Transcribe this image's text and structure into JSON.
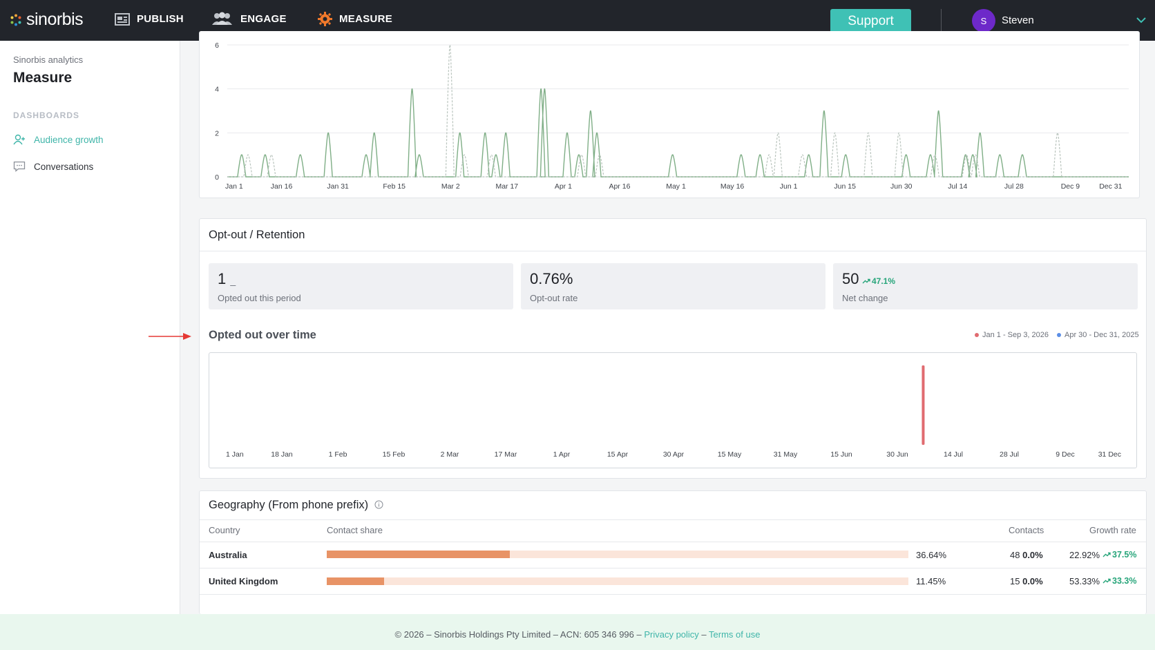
{
  "brand": {
    "name": "sinorbis"
  },
  "nav": {
    "publish": "PUBLISH",
    "engage": "ENGAGE",
    "measure": "MEASURE",
    "support": "Support",
    "user_initial": "S",
    "user_name": "Steven"
  },
  "sidebar": {
    "subtitle": "Sinorbis analytics",
    "title": "Measure",
    "section": "DASHBOARDS",
    "items": [
      {
        "label": "Audience growth",
        "icon": "user-icon",
        "active": true
      },
      {
        "label": "Conversations",
        "icon": "chat-icon",
        "active": false
      }
    ]
  },
  "top_chart": {
    "y_ticks": [
      "0",
      "2",
      "4",
      "6"
    ],
    "x_ticks": [
      "Jan 1",
      "Jan 16",
      "Jan 31",
      "Feb 15",
      "Mar 2",
      "Mar 17",
      "Apr 1",
      "Apr 16",
      "May 1",
      "May 16",
      "Jun 1",
      "Jun 15",
      "Jun 30",
      "Jul 14",
      "Jul 28",
      "Dec 9",
      "Dec 31"
    ]
  },
  "optout": {
    "title": "Opt-out / Retention",
    "stats": [
      {
        "value": "1",
        "suffix": "_",
        "label": "Opted out this period"
      },
      {
        "value": "0.76%",
        "label": "Opt-out rate"
      },
      {
        "value": "50",
        "trend": "47.1%",
        "label": "Net change"
      }
    ],
    "chart_title": "Opted out over time",
    "legend": [
      {
        "label": "Jan 1 - Sep 3, 2026",
        "color": "#e06b70"
      },
      {
        "label": "Apr 30 - Dec 31, 2025",
        "color": "#5b8ee6"
      }
    ],
    "x_ticks": [
      "1 Jan",
      "18 Jan",
      "1 Feb",
      "15 Feb",
      "2 Mar",
      "17 Mar",
      "1 Apr",
      "15 Apr",
      "30 Apr",
      "15 May",
      "31 May",
      "15 Jun",
      "30 Jun",
      "14 Jul",
      "28 Jul",
      "9 Dec",
      "31 Dec"
    ]
  },
  "chart_data": [
    {
      "type": "line",
      "title": "",
      "ylim": [
        0,
        6
      ],
      "x": [
        "Jan 1",
        "Jan 16",
        "Jan 31",
        "Feb 15",
        "Mar 2",
        "Mar 17",
        "Apr 1",
        "Apr 16",
        "May 1",
        "May 16",
        "Jun 1",
        "Jun 15",
        "Jun 30",
        "Jul 14",
        "Jul 28",
        "Dec 9",
        "Dec 31"
      ],
      "series": [
        {
          "color": "#7fae86",
          "style": "solid",
          "spikes": [
            [
              1.6,
              1
            ],
            [
              4.2,
              1
            ],
            [
              8.1,
              1
            ],
            [
              11.2,
              2
            ],
            [
              15.4,
              1
            ],
            [
              16.3,
              2
            ],
            [
              20.5,
              4
            ],
            [
              21.3,
              1
            ],
            [
              25.8,
              2
            ],
            [
              28.6,
              2
            ],
            [
              29.8,
              1
            ],
            [
              30.9,
              2
            ],
            [
              34.8,
              4
            ],
            [
              35.2,
              4
            ],
            [
              37.7,
              2
            ],
            [
              39.0,
              1
            ],
            [
              40.3,
              3
            ],
            [
              41.0,
              2
            ],
            [
              49.4,
              1
            ],
            [
              57.0,
              1
            ],
            [
              59.1,
              1
            ],
            [
              64.5,
              1
            ],
            [
              66.2,
              3
            ],
            [
              68.6,
              1
            ],
            [
              75.3,
              1
            ],
            [
              78.0,
              1
            ],
            [
              78.9,
              3
            ],
            [
              81.9,
              1
            ],
            [
              82.7,
              1
            ],
            [
              83.5,
              2
            ],
            [
              85.7,
              1
            ],
            [
              88.2,
              1
            ]
          ]
        },
        {
          "color": "#b9c4bd",
          "style": "dashed",
          "spikes": [
            [
              2.3,
              1
            ],
            [
              4.9,
              1
            ],
            [
              24.7,
              6
            ],
            [
              26.3,
              1
            ],
            [
              29.3,
              1
            ],
            [
              39.3,
              1
            ],
            [
              41.3,
              1
            ],
            [
              60.1,
              1
            ],
            [
              61.1,
              2
            ],
            [
              63.8,
              1
            ],
            [
              67.4,
              2
            ],
            [
              71.1,
              2
            ],
            [
              74.5,
              2
            ],
            [
              78.5,
              1
            ],
            [
              82.0,
              1
            ],
            [
              83.0,
              1
            ],
            [
              92.1,
              2
            ]
          ]
        }
      ]
    },
    {
      "type": "bar",
      "title": "Opted out over time",
      "ylim": [
        0,
        1
      ],
      "x": [
        "1 Jan",
        "18 Jan",
        "1 Feb",
        "15 Feb",
        "2 Mar",
        "17 Mar",
        "1 Apr",
        "15 Apr",
        "30 Apr",
        "15 May",
        "31 May",
        "15 Jun",
        "30 Jun",
        "14 Jul",
        "28 Jul",
        "9 Dec",
        "31 Dec"
      ],
      "series": [
        {
          "name": "Jan 1 - Sep 3, 2026",
          "color": "#e06b70",
          "points": [
            [
              77.5,
              1
            ]
          ]
        },
        {
          "name": "Apr 30 - Dec 31, 2025",
          "color": "#5b8ee6",
          "points": []
        }
      ]
    }
  ],
  "geography": {
    "title": "Geography (From phone prefix)",
    "columns": [
      "Country",
      "Contact share",
      "Contacts",
      "Growth rate"
    ],
    "rows": [
      {
        "country": "Australia",
        "share_fraction": 0.3664,
        "share": "36.64%",
        "contacts": "48",
        "contacts_change": "0.0%",
        "growth": "22.92%",
        "growth_trend": "37.5%"
      },
      {
        "country": "United Kingdom",
        "share_fraction": 0.1145,
        "share": "11.45%",
        "contacts": "15",
        "contacts_change": "0.0%",
        "growth": "53.33%",
        "growth_trend": "33.3%"
      }
    ]
  },
  "footer": {
    "text": "© 2026 – Sinorbis Holdings Pty Limited – ACN: 605 346 996 – ",
    "privacy": "Privacy policy",
    "sep": " – ",
    "terms": "Terms of use"
  }
}
